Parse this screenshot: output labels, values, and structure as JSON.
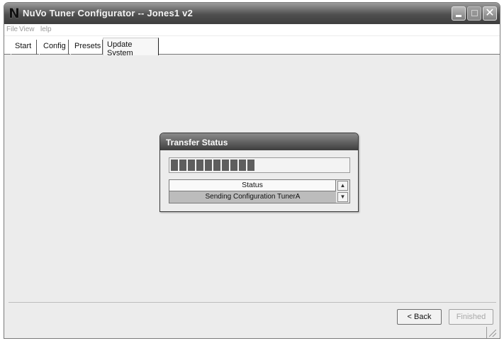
{
  "window": {
    "title": "NuVo Tuner Configurator -- Jones1 v2",
    "logo_letter": "N"
  },
  "menu": {
    "file": "File",
    "view": "View",
    "help": "lelp"
  },
  "tabs": [
    {
      "label": "Start",
      "active": false
    },
    {
      "label": "Config",
      "active": false
    },
    {
      "label": "Presets",
      "active": false
    },
    {
      "label": "Update System",
      "active": true
    }
  ],
  "dialog": {
    "title": "Transfer Status",
    "progress_blocks": 10,
    "progress_blocks_total": 21,
    "status_header": "Status",
    "status_row": "Sending Configuration TunerA"
  },
  "footer": {
    "back_label": "< Back",
    "finished_label": "Finished"
  },
  "icons": {
    "minimize": "minimize-icon",
    "maximize": "maximize-icon",
    "close": "close-icon",
    "scroll_up": "arrow-up-icon",
    "scroll_down": "arrow-down-icon",
    "resize": "resize-grip-icon"
  },
  "colors": {
    "titlebar": "#4f4f4f",
    "progress_block": "#5e5e5e",
    "selected_row": "#bcbcbc"
  }
}
